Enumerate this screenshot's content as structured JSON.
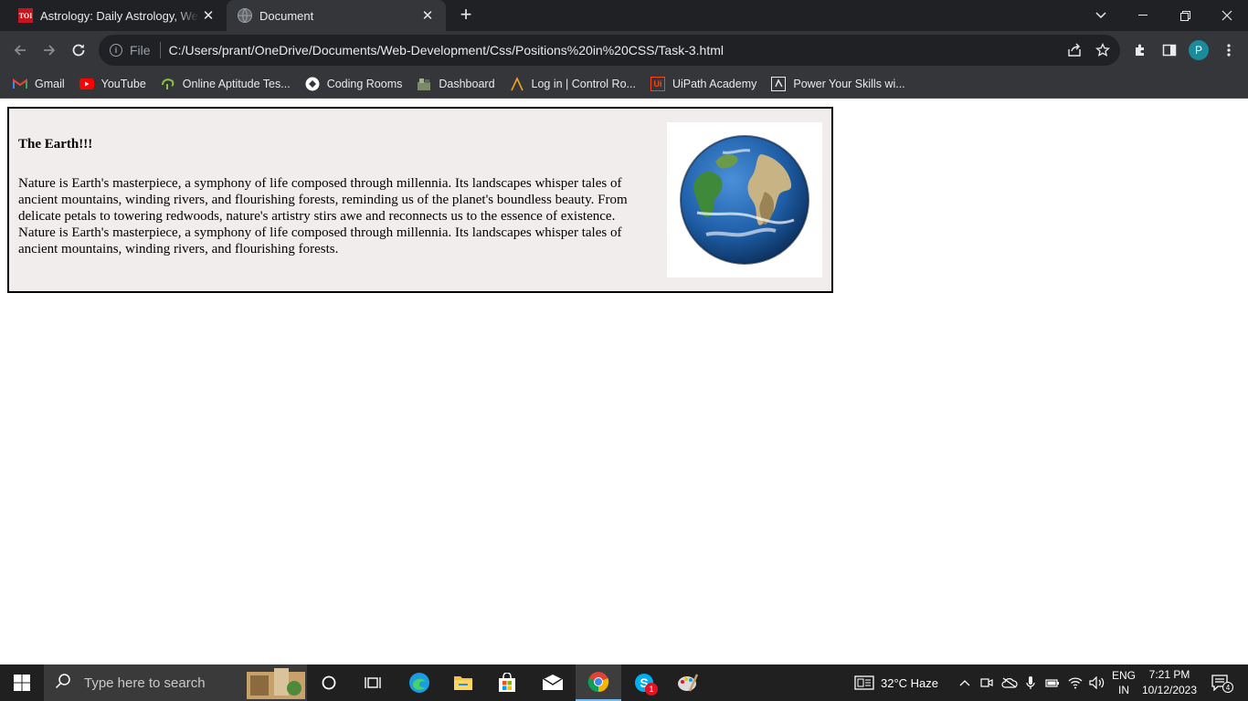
{
  "browser": {
    "tabs": [
      {
        "title": "Astrology: Daily Astrology, Weekly",
        "favicon": "toi-icon",
        "favicon_text": "TOI",
        "active": false
      },
      {
        "title": "Document",
        "favicon": "globe-icon",
        "active": true
      }
    ],
    "address": {
      "scheme_label": "File",
      "url": "C:/Users/prant/OneDrive/Documents/Web-Development/Css/Positions%20in%20CSS/Task-3.html"
    },
    "profile_initial": "P",
    "bookmarks": [
      {
        "label": "Gmail",
        "icon": "gmail-icon"
      },
      {
        "label": "YouTube",
        "icon": "youtube-icon"
      },
      {
        "label": "Online Aptitude Tes...",
        "icon": "aptitude-icon"
      },
      {
        "label": "Coding Rooms",
        "icon": "coding-rooms-icon"
      },
      {
        "label": "Dashboard",
        "icon": "dashboard-icon"
      },
      {
        "label": "Log in | Control Ro...",
        "icon": "control-room-icon"
      },
      {
        "label": "UiPath Academy",
        "icon": "uipath-icon",
        "icon_text": "Ui"
      },
      {
        "label": "Power Your Skills wi...",
        "icon": "power-skills-icon"
      }
    ]
  },
  "page": {
    "heading": "The Earth!!!",
    "paragraph": "Nature is Earth's masterpiece, a symphony of life composed through millennia. Its landscapes whisper tales of ancient mountains, winding rivers, and flourishing forests, reminding us of the planet's boundless beauty. From delicate petals to towering redwoods, nature's artistry stirs awe and reconnects us to the essence of existence. Nature is Earth's masterpiece, a symphony of life composed through millennia. Its landscapes whisper tales of ancient mountains, winding rivers, and flourishing forests.",
    "image": "earth-globe-image"
  },
  "taskbar": {
    "search_placeholder": "Type here to search",
    "weather": "32°C  Haze",
    "language": "ENG",
    "region": "IN",
    "time": "7:21 PM",
    "date": "10/12/2023",
    "skype_badge": "1",
    "notification_count": "4"
  },
  "colors": {
    "chrome_dark": "#202124",
    "chrome_toolbar": "#35363a",
    "card_background": "#f1edec",
    "taskbar": "#202020"
  }
}
